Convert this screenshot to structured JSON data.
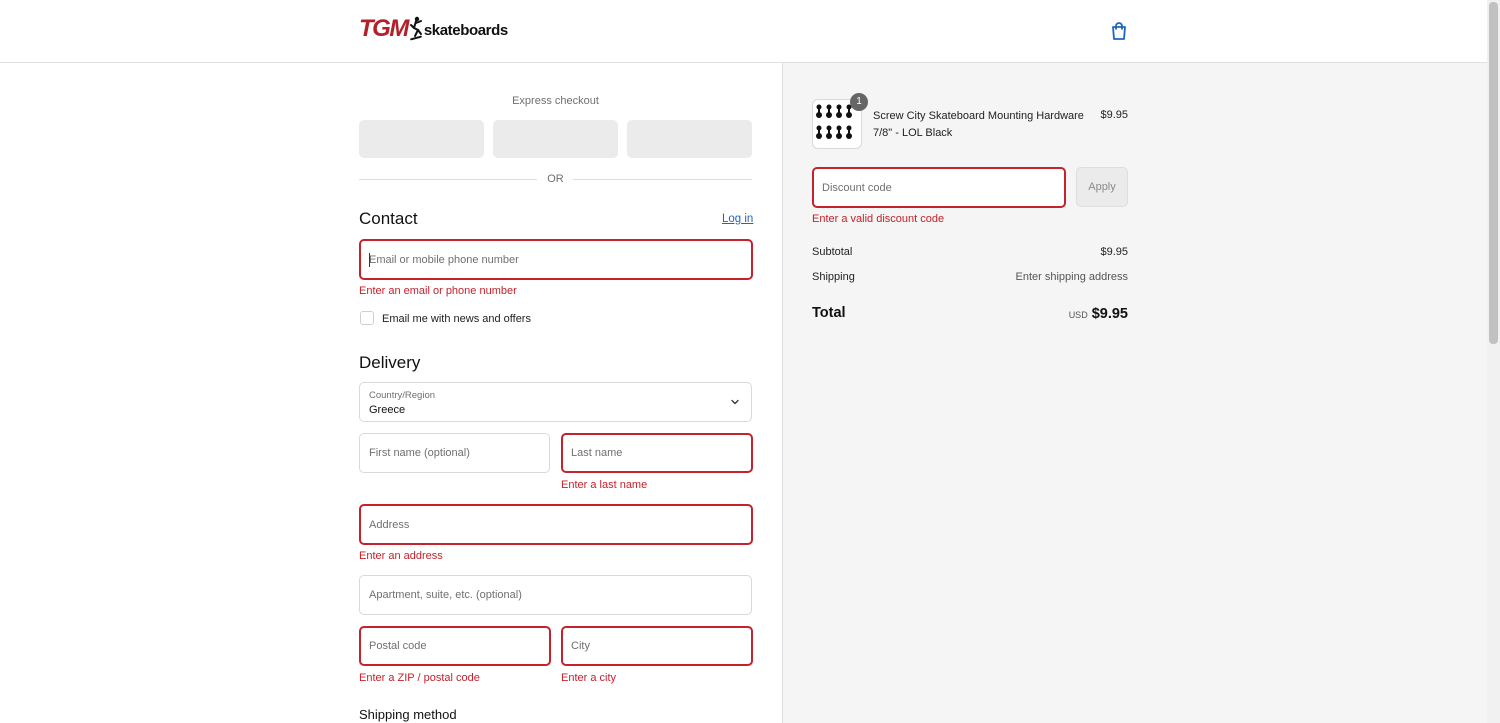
{
  "header": {
    "logo_primary": "TGM",
    "logo_secondary": "skateboards",
    "cart_icon": "shopping-bag-icon"
  },
  "express": {
    "label": "Express checkout",
    "divider": "OR"
  },
  "contact": {
    "heading": "Contact",
    "login_link": "Log in",
    "email_placeholder": "Email or mobile phone number",
    "email_error": "Enter an email or phone number",
    "newsletter_label": "Email me with news and offers"
  },
  "delivery": {
    "heading": "Delivery",
    "country_label": "Country/Region",
    "country_value": "Greece",
    "first_name_placeholder": "First name (optional)",
    "last_name_placeholder": "Last name",
    "last_name_error": "Enter a last name",
    "address_placeholder": "Address",
    "address_error": "Enter an address",
    "apartment_placeholder": "Apartment, suite, etc. (optional)",
    "postal_placeholder": "Postal code",
    "postal_error": "Enter a ZIP / postal code",
    "city_placeholder": "City",
    "city_error": "Enter a city",
    "shipping_method_heading": "Shipping method"
  },
  "summary": {
    "product": {
      "quantity": "1",
      "name": "Screw City Skateboard Mounting Hardware 7/8\" - LOL Black",
      "price": "$9.95"
    },
    "discount_placeholder": "Discount code",
    "apply_label": "Apply",
    "discount_error": "Enter a valid discount code",
    "subtotal_label": "Subtotal",
    "subtotal_value": "$9.95",
    "shipping_label": "Shipping",
    "shipping_value": "Enter shipping address",
    "total_label": "Total",
    "currency": "USD",
    "total_value": "$9.95"
  },
  "colors": {
    "error": "#c4222c",
    "link": "#1f66c2",
    "brand_red": "#b3202a",
    "summary_bg": "#f5f5f5"
  }
}
